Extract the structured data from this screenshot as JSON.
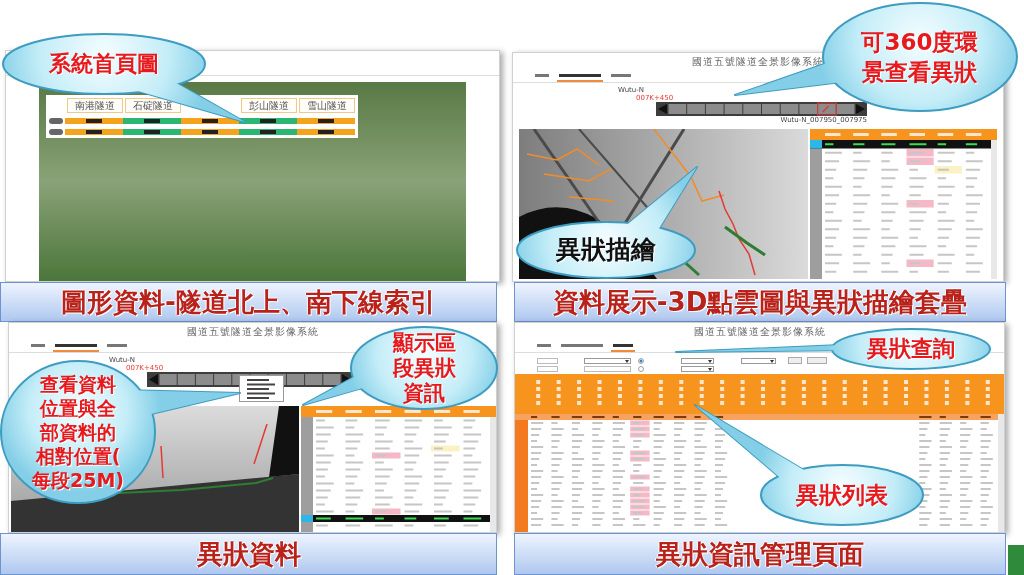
{
  "home_panel": {
    "callouts": [
      {
        "lines": [
          "系統首頁圖"
        ],
        "color": "#e8191c"
      }
    ],
    "tunnel_bar": {
      "columns": [
        {
          "name": "南港隧道",
          "segments": [
            {
              "color": "#f5a21c"
            },
            {
              "color": "#f5a21c"
            }
          ]
        },
        {
          "name": "石碇隧道",
          "segments": [
            {
              "color": "#2bb673"
            },
            {
              "color": "#2bb673"
            }
          ]
        },
        {
          "segments": [
            {
              "color": "#f5a21c"
            },
            {
              "color": "#f5a21c"
            }
          ]
        },
        {
          "name": "彭山隧道",
          "segments": [
            {
              "color": "#2bb673"
            },
            {
              "color": "#2bb673"
            }
          ]
        },
        {
          "name": "雪山隧道",
          "segments": [
            {
              "color": "#f5a21c"
            },
            {
              "color": "#f5a21c"
            }
          ]
        }
      ]
    },
    "caption": "圖形資料-隧道北上、南下線索引"
  },
  "pointcloud_panel": {
    "window_title": "國道五號隧道全景影像系統",
    "tabs": [
      {
        "selected": false
      },
      {
        "selected": true
      },
      {
        "selected": false
      }
    ],
    "track_label": "Wutu-N",
    "km_label": "007K+450",
    "strip_label": "Wutu-N_007950_007975",
    "callouts": [
      {
        "lines": [
          "可360度環",
          "景查看異狀"
        ],
        "color": "#e8191c"
      },
      {
        "lines": [
          "異狀描繪"
        ],
        "color": "#111111"
      }
    ],
    "caption": "資料展示-3D點雲圖與異狀描繪套疊"
  },
  "anomaly_panel": {
    "window_title": "國道五號隧道全景影像系統",
    "tabs": [
      {
        "selected": false
      },
      {
        "selected": true
      },
      {
        "selected": false
      }
    ],
    "track_label": "Wutu-N",
    "km_label": "007K+450",
    "callouts": [
      {
        "lines": [
          "查看資料",
          "位置與全",
          "部資料的",
          "相對位置(",
          "每段25M)"
        ],
        "color": "#e8191c"
      },
      {
        "lines": [
          "顯示區",
          "段異狀",
          "資訊"
        ],
        "color": "#e8191c"
      }
    ],
    "caption": "異狀資料"
  },
  "management_panel": {
    "window_title": "國道五號隧道全景影像系統",
    "tabs": [
      {
        "selected": false
      },
      {
        "selected": false
      },
      {
        "selected": true
      }
    ],
    "query_form": {
      "radios": [
        {
          "selected": true
        },
        {
          "selected": false
        }
      ]
    },
    "callouts": [
      {
        "lines": [
          "異狀查詢"
        ],
        "color": "#e8191c"
      },
      {
        "lines": [
          "異狀列表"
        ],
        "color": "#e8191c"
      }
    ],
    "caption": "異狀資訊管理頁面"
  }
}
